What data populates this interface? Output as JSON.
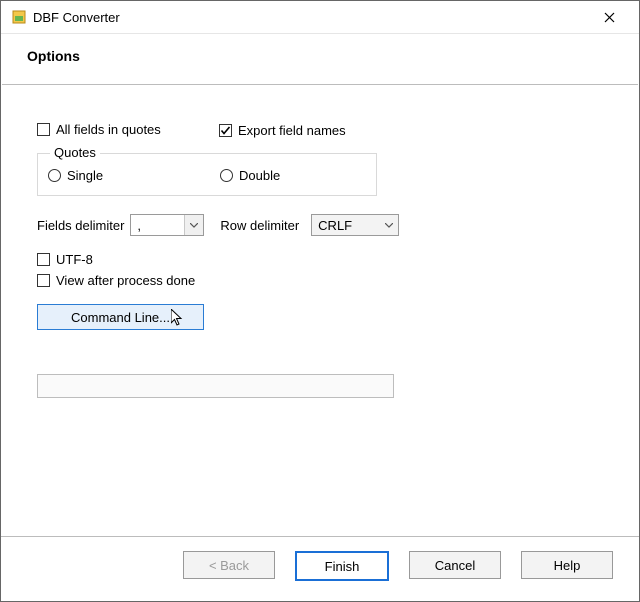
{
  "window": {
    "title": "DBF Converter"
  },
  "header": {
    "title": "Options"
  },
  "options": {
    "all_fields_in_quotes": {
      "label": "All fields in quotes",
      "checked": false
    },
    "export_field_names": {
      "label": "Export field names",
      "checked": true
    },
    "utf8": {
      "label": "UTF-8",
      "checked": false
    },
    "view_after": {
      "label": "View after process done",
      "checked": false
    }
  },
  "quotes_group": {
    "legend": "Quotes",
    "single": {
      "label": "Single",
      "selected": false
    },
    "double": {
      "label": "Double",
      "selected": false
    }
  },
  "delimiters": {
    "fields_label": "Fields delimiter",
    "fields_value": ",",
    "row_label": "Row delimiter",
    "row_value": "CRLF"
  },
  "command_line": {
    "label": "Command Line..."
  },
  "footer": {
    "back": "< Back",
    "finish": "Finish",
    "cancel": "Cancel",
    "help": "Help"
  }
}
